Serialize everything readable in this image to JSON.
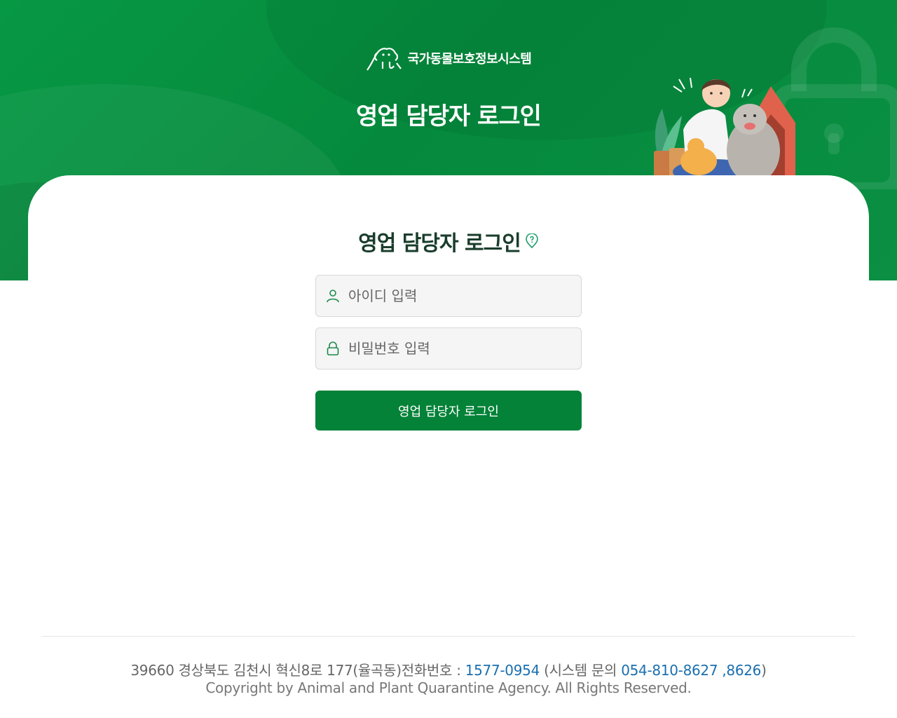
{
  "brand": {
    "name": "국가동물보호정보시스템",
    "logo_icon": "dog-logo-icon"
  },
  "hero": {
    "title": "영업 담당자 로그인"
  },
  "card": {
    "title": "영업 담당자 로그인",
    "help_icon": "help-pin-icon"
  },
  "form": {
    "id_placeholder": "아이디 입력",
    "password_placeholder": "비밀번호 입력",
    "login_label": "영업 담당자 로그인"
  },
  "footer": {
    "address": "39660 경상북도 김천시 혁신8로 177(율곡동)전화번호 : ",
    "phone": "1577-0954",
    "system_prefix": " (시스템 문의 ",
    "system_phone": "054-810-8627 ,8626",
    "system_suffix": ")",
    "copyright": "Copyright by Animal and Plant Quarantine Agency. All Rights Reserved."
  },
  "colors": {
    "primary": "#048238",
    "hero_green": "#079844",
    "title_dark": "#1a3d2b",
    "link_blue": "#1a6fb0"
  }
}
